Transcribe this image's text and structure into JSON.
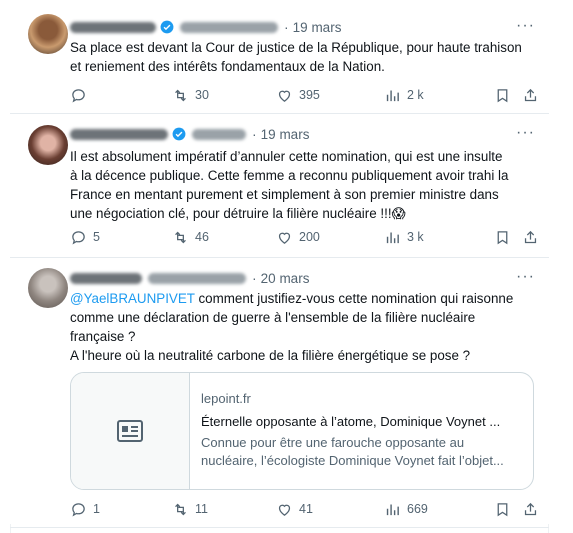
{
  "tweets": [
    {
      "date": "19 mars",
      "text": "Sa place est devant la Cour de justice de la République, pour haute trahison\net reniement des intérêts fondamentaux de la Nation.",
      "replies": "",
      "retweets": "30",
      "likes": "395",
      "views": "2 k"
    },
    {
      "date": "19 mars",
      "text": "Il est absolument impératif d’annuler cette nomination, qui est une insulte\nà la décence publique. Cette femme a reconnu publiquement avoir trahi la\nFrance en mentant purement et simplement à son premier ministre dans\nune négociation clé, pour détruire la filière nucléaire !!!",
      "emoji": "😱",
      "replies": "5",
      "retweets": "46",
      "likes": "200",
      "views": "3 k"
    },
    {
      "date": "20 mars",
      "mention": "@YaelBRAUNPIVET",
      "text": " comment justifiez-vous cette nomination qui raisonne\ncomme une déclaration de guerre à l'ensemble de la filière nucléaire\nfrançaise ?\nA l'heure où la neutralité carbone de la filière énergétique se pose ?",
      "card": {
        "domain": "lepoint.fr",
        "title": "Éternelle opposante à l’atome, Dominique Voynet ...",
        "description": "Connue pour être une farouche opposante au\nnucléaire, l’écologiste Dominique Voynet fait l’objet...",
        "icon": "article-icon"
      },
      "replies": "1",
      "retweets": "11",
      "likes": "41",
      "views": "669"
    }
  ],
  "icons": {
    "more": "more-icon",
    "reply": "reply-icon",
    "retweet": "retweet-icon",
    "like": "like-icon",
    "views": "views-icon",
    "bookmark": "bookmark-icon",
    "share": "share-icon",
    "verified": "verified-badge-icon"
  },
  "colors": {
    "accent": "#1d9bf0",
    "muted": "#536471",
    "text": "#0f1419",
    "border": "#cfd9de"
  },
  "more_label": "···",
  "date_separator": "·"
}
